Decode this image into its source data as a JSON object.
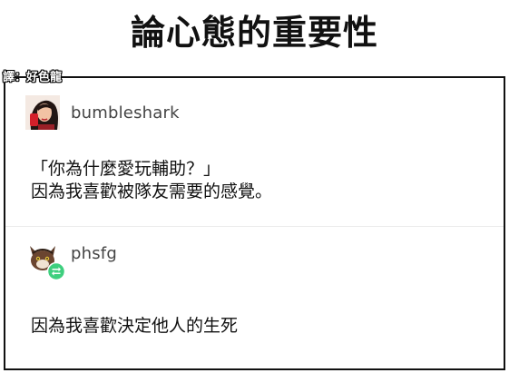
{
  "title": "論心態的重要性",
  "credit": "譯：好色龍",
  "posts": [
    {
      "username": "bumbleshark",
      "avatar_icon": "cartoon-woman-avatar-icon",
      "lines": [
        "「你為什麼愛玩輔助？」",
        "因為我喜歡被隊友需要的感覺。"
      ]
    },
    {
      "username": "phsfg",
      "avatar_icon": "cat-avatar-with-reblog-icon",
      "lines": [
        "因為我喜歡決定他人的生死"
      ]
    }
  ],
  "colors": {
    "text": "#111111",
    "username": "#444444",
    "reblog_badge": "#3ecf7e",
    "border": "#111111"
  }
}
